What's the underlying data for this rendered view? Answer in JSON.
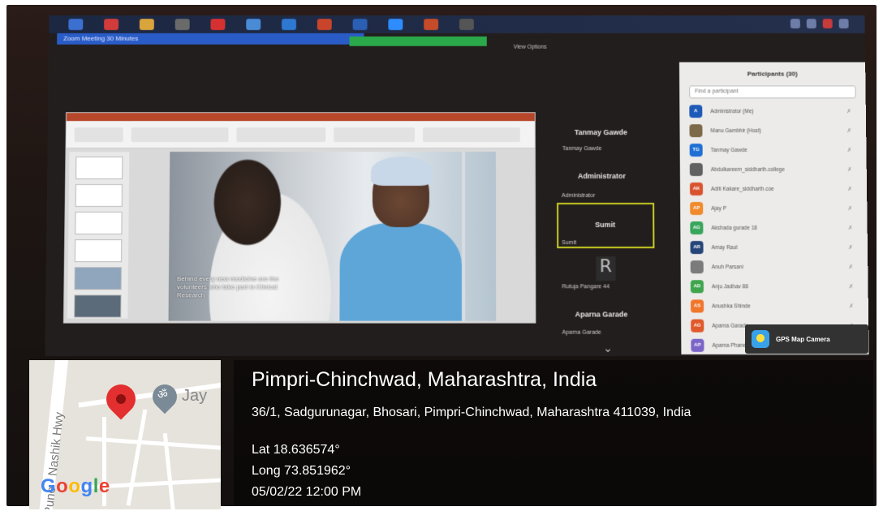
{
  "zoom": {
    "meeting_title": "Zoom Meeting 30 Minutes",
    "view_options": "View Options"
  },
  "slide": {
    "caption": "Behind every new medicine are the volunteers who take part in Clinical Research"
  },
  "video_tiles": [
    {
      "name": "Tanmay Gawde",
      "sub": "Tanmay Gawde"
    },
    {
      "name": "Administrator",
      "sub": "Administrator"
    },
    {
      "name": "Sumit",
      "sub": "Sumit"
    },
    {
      "name": "",
      "sub": "Rutuja Pangare 44"
    },
    {
      "name": "Aparna Garade",
      "sub": "Aparna Garade"
    }
  ],
  "participants": {
    "title": "Participants (30)",
    "search_placeholder": "Find a participant",
    "items": [
      {
        "initials": "A",
        "name": "Administrator (Me)",
        "color": "#1e5bb8"
      },
      {
        "initials": "",
        "name": "Manu Gambhir (Host)",
        "color": "#7d6a4a"
      },
      {
        "initials": "TG",
        "name": "Tanmay Gawde",
        "color": "#1f6fd4"
      },
      {
        "initials": "",
        "name": "Abdulkareem_siddharth.college",
        "color": "#616161"
      },
      {
        "initials": "AK",
        "name": "Aditi Kakare_siddharth.coe",
        "color": "#d9532f"
      },
      {
        "initials": "AP",
        "name": "Ajay P",
        "color": "#f08a2b"
      },
      {
        "initials": "AG",
        "name": "Akshada gurade 18",
        "color": "#37a65b"
      },
      {
        "initials": "AR",
        "name": "Amay Raut",
        "color": "#26467a"
      },
      {
        "initials": "",
        "name": "Anuh Parsani",
        "color": "#7b7b7b"
      },
      {
        "initials": "AD",
        "name": "Anju Jadhav 88",
        "color": "#3ea54d"
      },
      {
        "initials": "AS",
        "name": "Anushka Shinde",
        "color": "#f0762b"
      },
      {
        "initials": "AG",
        "name": "Aparna Garade",
        "color": "#e05a2b"
      },
      {
        "initials": "AP",
        "name": "Aparna Phane",
        "color": "#7b65c9"
      }
    ]
  },
  "gps_badge": "GPS Map Camera",
  "location": {
    "title": "Pimpri-Chinchwad, Maharashtra, India",
    "address": "36/1, Sadgurunagar, Bhosari, Pimpri-Chinchwad, Maharashtra 411039, India",
    "lat": "Lat 18.636574°",
    "long": "Long 73.851962°",
    "datetime": "05/02/22 12:00 PM"
  },
  "map": {
    "road_label": "Pune - Nashik Hwy",
    "place_label": "Jay",
    "om_glyph": "ॐ",
    "google_letters": [
      {
        "ch": "G",
        "color": "#4285f4"
      },
      {
        "ch": "o",
        "color": "#ea4335"
      },
      {
        "ch": "o",
        "color": "#fbbc05"
      },
      {
        "ch": "g",
        "color": "#4285f4"
      },
      {
        "ch": "l",
        "color": "#34a853"
      },
      {
        "ch": "e",
        "color": "#ea4335"
      }
    ]
  }
}
